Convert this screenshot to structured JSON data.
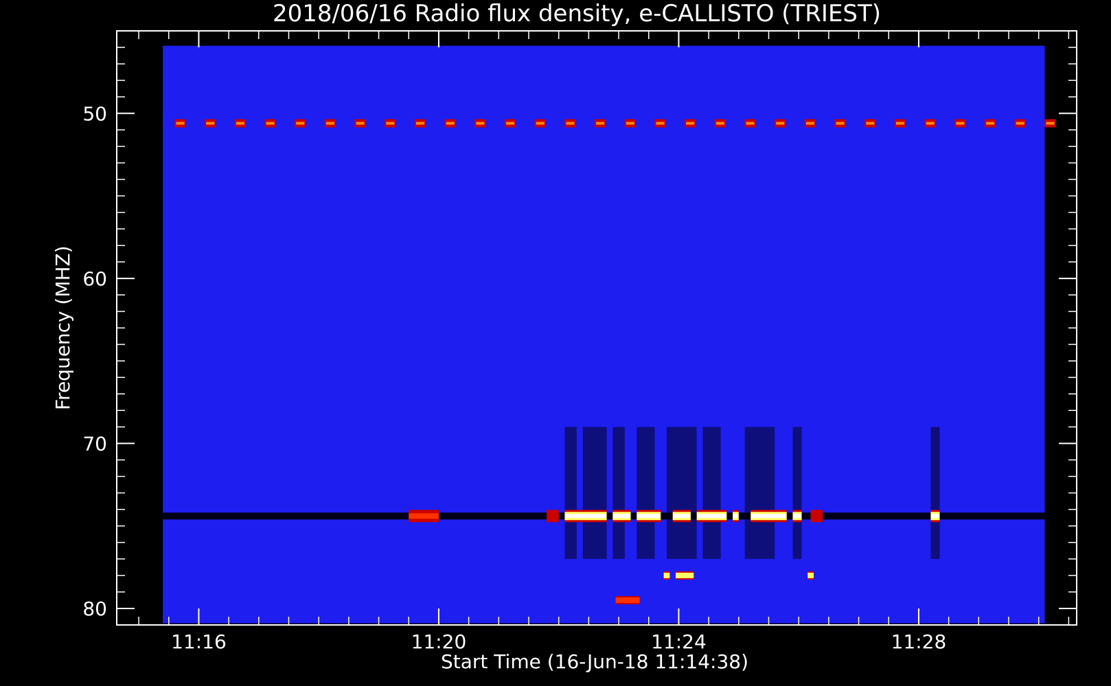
{
  "chart_data": {
    "type": "heatmap",
    "title": "2018/06/16  Radio flux density, e-CALLISTO (TRIEST)",
    "xlabel": "Start Time (16-Jun-18 11:14:38)",
    "ylabel": "Frequency (MHZ)",
    "x_unit": "time of day (minutes after 11:00)",
    "y_unit": "MHz",
    "xlim": [
      14.633,
      30.633
    ],
    "ylim": [
      45.0,
      81.0
    ],
    "y_inverted": true,
    "x_ticks": [
      {
        "value": 16,
        "label": "11:16"
      },
      {
        "value": 20,
        "label": "11:20"
      },
      {
        "value": 24,
        "label": "11:24"
      },
      {
        "value": 28,
        "label": "11:28"
      }
    ],
    "y_ticks": [
      {
        "value": 50,
        "label": "50"
      },
      {
        "value": 60,
        "label": "60"
      },
      {
        "value": 70,
        "label": "70"
      },
      {
        "value": 80,
        "label": "80"
      }
    ],
    "x_minor_step": 0.5,
    "y_minor_step": 1,
    "colormap": [
      "#0000ff",
      "#00008b",
      "#000000",
      "#cc0000",
      "#ff6600",
      "#ffff66",
      "#ffffff"
    ],
    "background_color": "#1e1ef0",
    "data_range": [
      15.4,
      30.1,
      45.9,
      80.9
    ],
    "interference_line_50MHz": {
      "freq": 50.6,
      "start": 15.6,
      "step": 0.5,
      "count": 30
    },
    "dark_band_74MHz": {
      "freq": 74.4,
      "start": 15.4,
      "end": 30.1
    },
    "bursts_74MHz": [
      {
        "start": 22.1,
        "end": 22.8,
        "intensity": "high"
      },
      {
        "start": 22.9,
        "end": 23.2,
        "intensity": "high"
      },
      {
        "start": 23.3,
        "end": 23.7,
        "intensity": "high"
      },
      {
        "start": 23.9,
        "end": 24.2,
        "intensity": "high"
      },
      {
        "start": 24.3,
        "end": 24.8,
        "intensity": "high"
      },
      {
        "start": 24.9,
        "end": 25.0,
        "intensity": "high"
      },
      {
        "start": 25.2,
        "end": 25.8,
        "intensity": "high"
      },
      {
        "start": 25.9,
        "end": 26.05,
        "intensity": "high"
      },
      {
        "start": 28.2,
        "end": 28.35,
        "intensity": "high"
      },
      {
        "start": 19.5,
        "end": 20.0,
        "intensity": "medium"
      },
      {
        "start": 21.8,
        "end": 22.0,
        "intensity": "low"
      },
      {
        "start": 26.2,
        "end": 26.4,
        "intensity": "low"
      }
    ],
    "dark_columns": [
      {
        "start": 22.1,
        "end": 22.3,
        "fmin": 69,
        "fmax": 77
      },
      {
        "start": 22.4,
        "end": 22.8,
        "fmin": 69,
        "fmax": 77
      },
      {
        "start": 22.9,
        "end": 23.1,
        "fmin": 69,
        "fmax": 77
      },
      {
        "start": 23.3,
        "end": 23.6,
        "fmin": 69,
        "fmax": 77
      },
      {
        "start": 23.8,
        "end": 24.3,
        "fmin": 69,
        "fmax": 77
      },
      {
        "start": 24.4,
        "end": 24.7,
        "fmin": 69,
        "fmax": 77
      },
      {
        "start": 25.1,
        "end": 25.6,
        "fmin": 69,
        "fmax": 77
      },
      {
        "start": 25.9,
        "end": 26.05,
        "fmin": 69,
        "fmax": 77
      },
      {
        "start": 28.2,
        "end": 28.35,
        "fmin": 69,
        "fmax": 77
      }
    ],
    "bursts_78MHz": [
      {
        "start": 23.75,
        "end": 23.85,
        "intensity": "high"
      },
      {
        "start": 23.95,
        "end": 24.25,
        "intensity": "high"
      },
      {
        "start": 26.15,
        "end": 26.25,
        "intensity": "high"
      },
      {
        "start": 22.95,
        "end": 23.35,
        "intensity": "medium",
        "freq": 79.5
      }
    ]
  }
}
